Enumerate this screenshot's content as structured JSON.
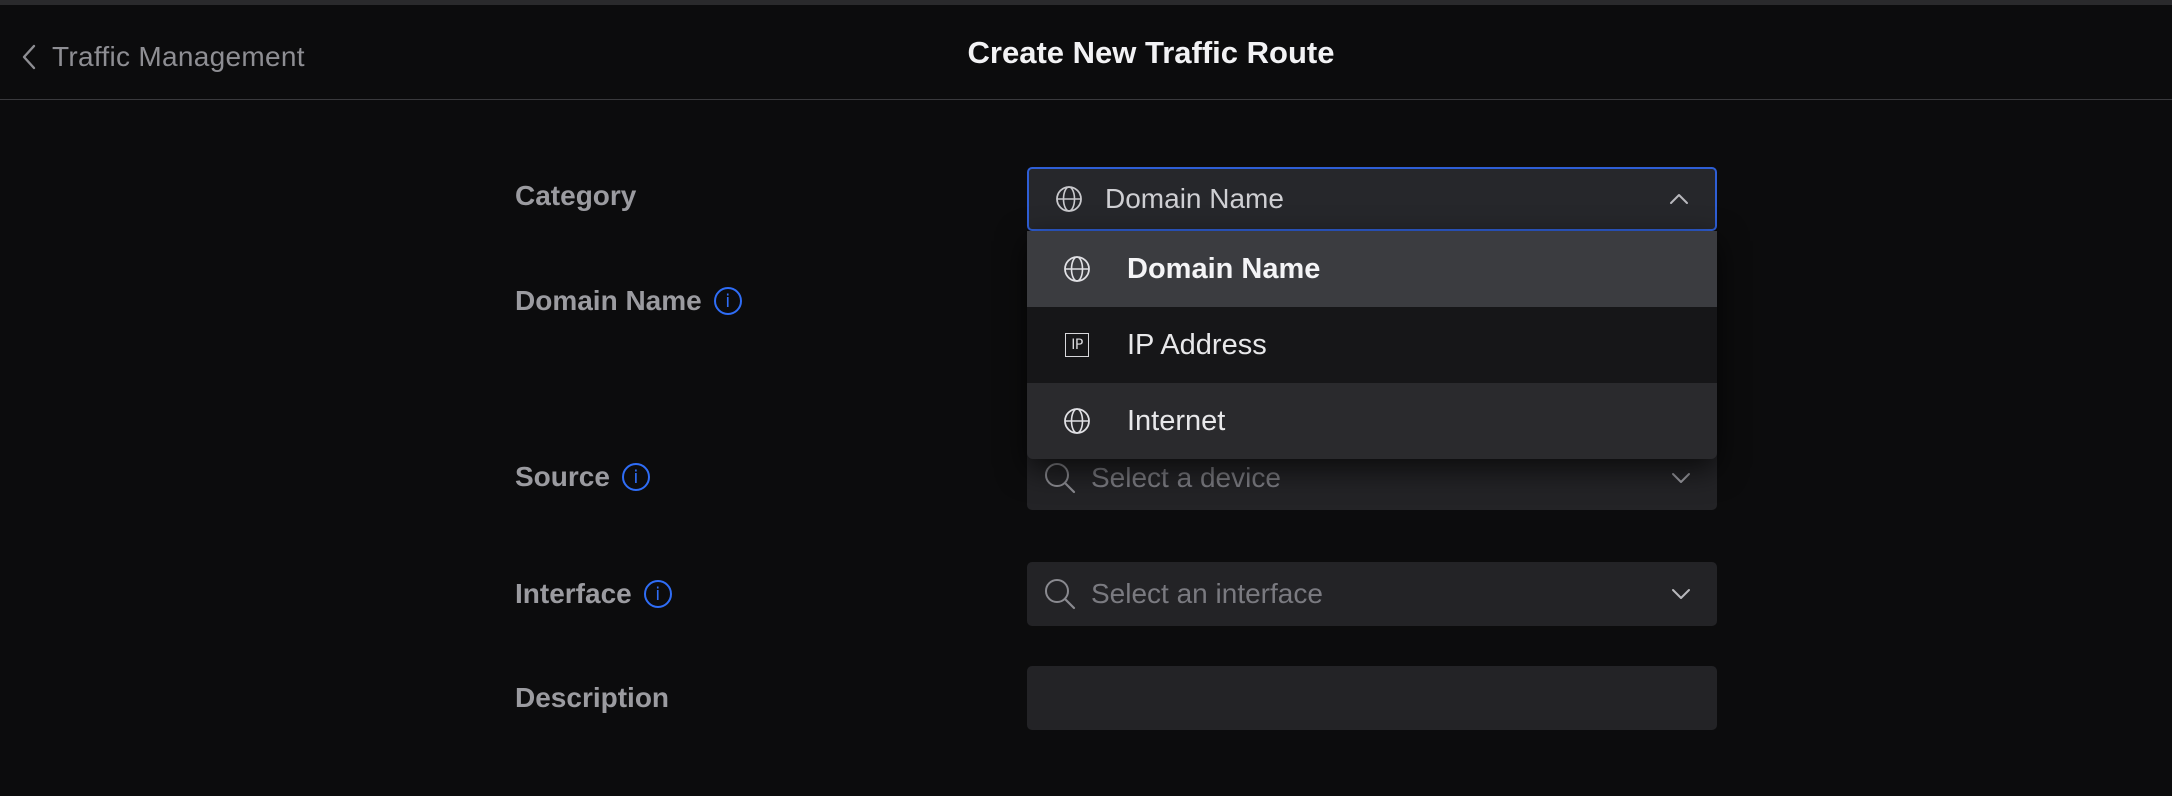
{
  "header": {
    "back_label": "Traffic Management",
    "title": "Create New Traffic Route"
  },
  "form": {
    "category": {
      "label": "Category",
      "selected": "Domain Name",
      "icon": "globe-icon",
      "options": [
        {
          "label": "Domain Name",
          "icon": "globe-icon",
          "selected": true
        },
        {
          "label": "IP Address",
          "icon": "ip-icon",
          "selected": false
        },
        {
          "label": "Internet",
          "icon": "globe-icon",
          "selected": false
        }
      ]
    },
    "domain_name": {
      "label": "Domain Name",
      "info_icon": "info-icon"
    },
    "source": {
      "label": "Source",
      "placeholder": "Select a device",
      "info_icon": "info-icon"
    },
    "interface": {
      "label": "Interface",
      "placeholder": "Select an interface",
      "info_icon": "info-icon"
    },
    "description": {
      "label": "Description",
      "value": ""
    }
  },
  "colors": {
    "accent": "#2f6df6",
    "background": "#0c0c0d",
    "field": "#232326",
    "selected_option": "#3b3c40"
  }
}
